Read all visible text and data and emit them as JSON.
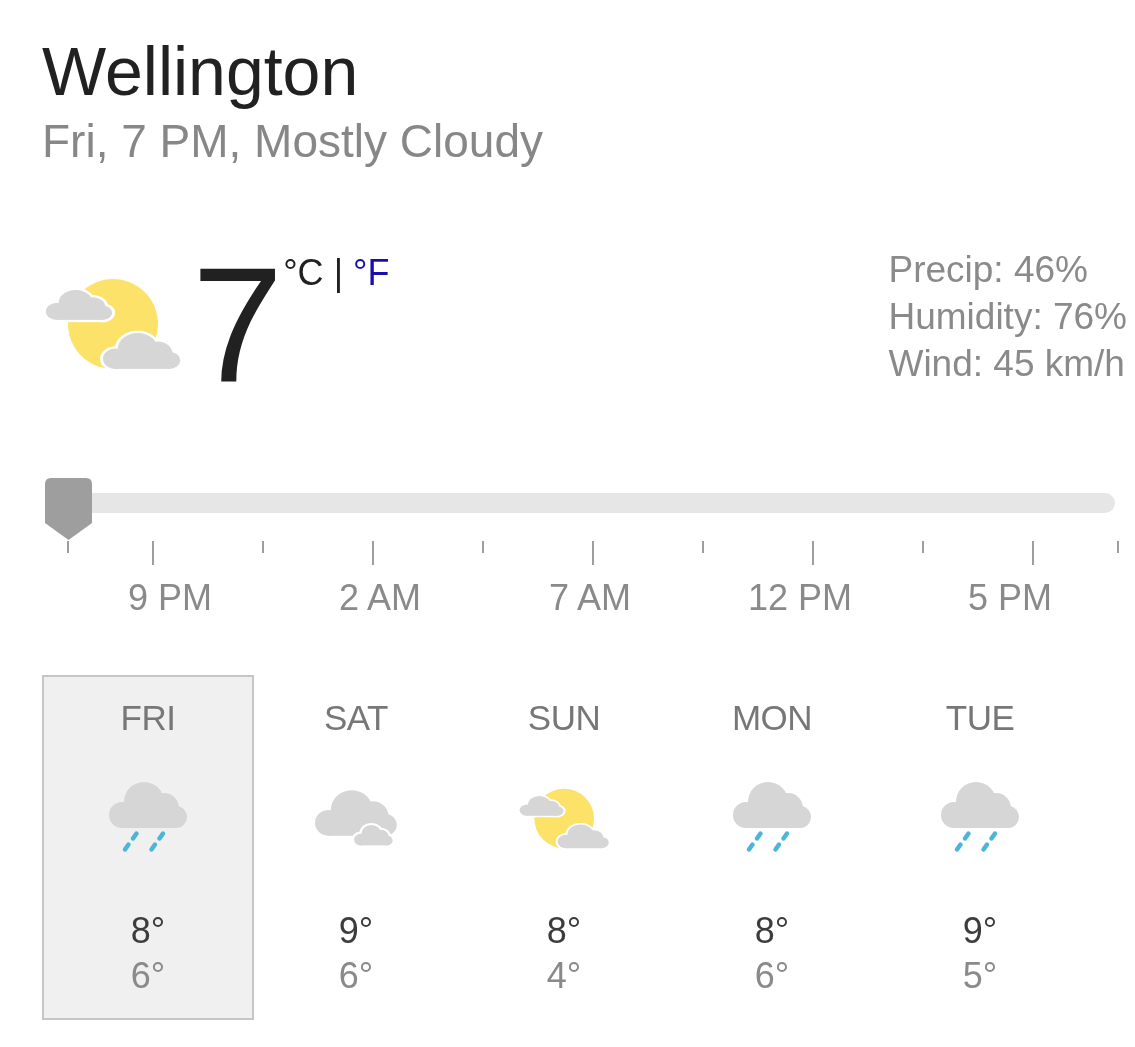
{
  "location": "Wellington",
  "summary": "Fri, 7 PM, Mostly Cloudy",
  "current": {
    "kind": "partly_cloudy",
    "temperature": "7",
    "units": [
      {
        "label": "°C",
        "selected": true
      },
      {
        "label": "°F",
        "selected": false
      }
    ],
    "separator": "|",
    "details": [
      "Precip: 46%",
      "Humidity: 76%",
      "Wind: 45 km/h"
    ]
  },
  "timeline": {
    "level": 0,
    "labels": [
      "9 PM",
      "2 AM",
      "7 AM",
      "12 PM",
      "5 PM"
    ]
  },
  "days": [
    {
      "day": "FRI",
      "kind": "rain",
      "high": "8°",
      "low": "6°",
      "selected": true
    },
    {
      "day": "SAT",
      "kind": "cloudy",
      "high": "9°",
      "low": "6°",
      "selected": false
    },
    {
      "day": "SUN",
      "kind": "partly_cloudy",
      "high": "8°",
      "low": "4°",
      "selected": false
    },
    {
      "day": "MON",
      "kind": "rain",
      "high": "8°",
      "low": "6°",
      "selected": false
    },
    {
      "day": "TUE",
      "kind": "rain",
      "high": "9°",
      "low": "5°",
      "selected": false
    }
  ]
}
